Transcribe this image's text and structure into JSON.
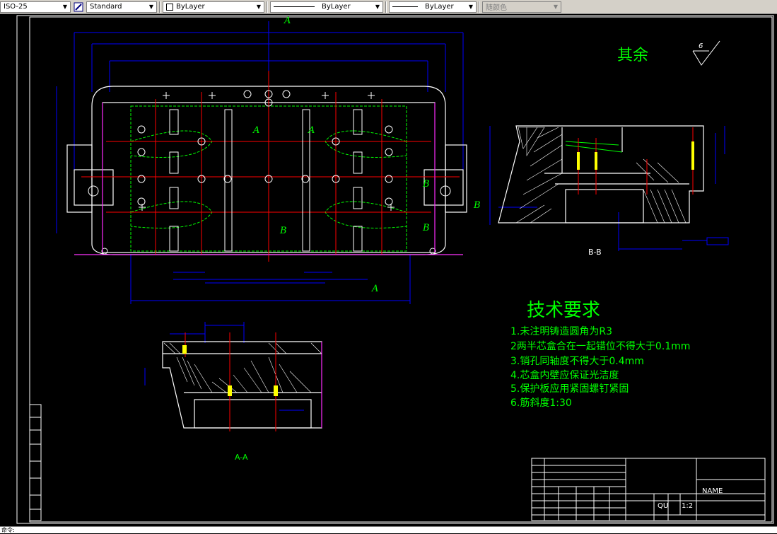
{
  "toolbar": {
    "dimstyle": {
      "value": "ISO-25"
    },
    "textstyle": {
      "value": "Standard"
    },
    "layer": {
      "value": "ByLayer"
    },
    "linetype": {
      "value": "ByLayer"
    },
    "lineweight": {
      "value": "ByLayer"
    },
    "color": {
      "value": "随颜色"
    }
  },
  "drawing": {
    "section_letter_a": "A",
    "section_letter_b": "B",
    "qiyu": "其余",
    "roughness": "6",
    "bb_label": "B-B",
    "aa_label": "A-A",
    "tech_title": "技术要求",
    "requirements": [
      "1.未注明铸造圆角为R3",
      "2两半芯盒合在一起错位不得大于0.1mm",
      "3.销孔同轴度不得大于0.4mm",
      "4.芯盒内壁应保证光洁度",
      "5.保护板应用紧固螺钉紧固",
      "6.筋斜度1:30"
    ],
    "title_block": {
      "name": "NAME",
      "material": "QU",
      "scale": "1:2"
    }
  },
  "colors": {
    "background": "#000000",
    "outline": "#ffffff",
    "dimension": "#0000ff",
    "center_line": "#ff0000",
    "hidden_line": "#00ff00",
    "text": "#00ff00",
    "magenta": "#ff00ff"
  },
  "status": {
    "prompt": "命令:"
  }
}
